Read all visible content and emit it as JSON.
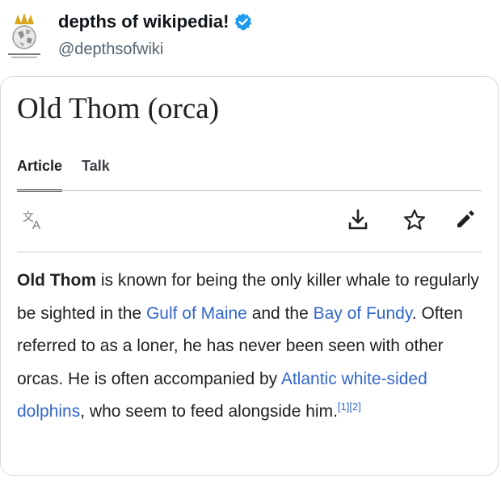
{
  "tweet": {
    "display_name": "depths of wikipedia!",
    "handle": "@depthsofwiki",
    "verified": true
  },
  "wiki": {
    "title": "Old Thom (orca)",
    "tabs": [
      {
        "label": "Article",
        "active": true
      },
      {
        "label": "Talk",
        "active": false
      }
    ],
    "toolbar_icons": [
      "language-icon",
      "download-icon",
      "star-icon",
      "edit-icon"
    ],
    "body": {
      "subject_bold": "Old Thom",
      "text_1": " is known for being the only killer whale to regularly be sighted in the ",
      "link_1": "Gulf of Maine",
      "text_2": " and the ",
      "link_2": "Bay of Fundy",
      "text_3": ". Often referred to as a loner, he has never been seen with other orcas. He is often accompanied by ",
      "link_3": "Atlantic white-sided dolphins",
      "text_4": ", who seem to feed alongside him.",
      "refs": "[1][2]"
    }
  },
  "colors": {
    "link": "#3366cc",
    "verified": "#1d9bf0",
    "text": "#202122",
    "handle": "#536471"
  }
}
